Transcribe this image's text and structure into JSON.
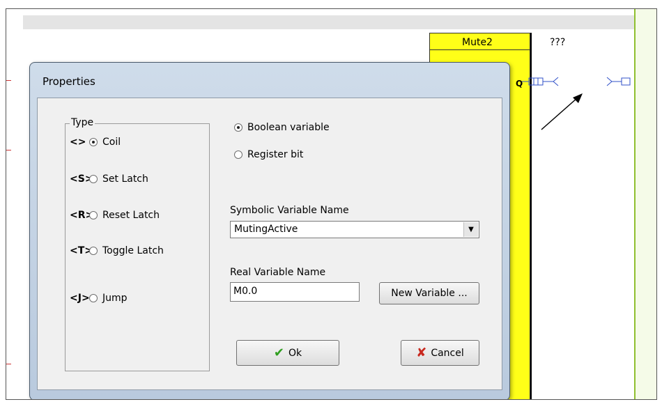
{
  "block": {
    "title": "Mute2"
  },
  "unknown_var": "???",
  "output_pin": "Q",
  "dialog": {
    "title": "Properties",
    "type_group_label": "Type",
    "types": [
      {
        "symbol": "<>",
        "label": "Coil",
        "checked": true
      },
      {
        "symbol": "<S>",
        "label": "Set Latch",
        "checked": false
      },
      {
        "symbol": "<R>",
        "label": "Reset Latch",
        "checked": false
      },
      {
        "symbol": "<T>",
        "label": "Toggle Latch",
        "checked": false
      },
      {
        "symbol": "<J>",
        "label": "Jump",
        "checked": false
      }
    ],
    "variable_kinds": [
      {
        "label": "Boolean variable",
        "checked": true
      },
      {
        "label": "Register bit",
        "checked": false
      }
    ],
    "symbolic_name": {
      "label": "Symbolic Variable Name",
      "value": "MutingActive"
    },
    "real_name": {
      "label": "Real Variable Name",
      "value": "M0.0"
    },
    "buttons": {
      "new_variable": "New Variable ...",
      "ok": "Ok",
      "cancel": "Cancel"
    }
  },
  "colors": {
    "block_fill": "#ffff18",
    "ok_icon": "#2f9e1f",
    "cancel_icon": "#c8281e"
  }
}
